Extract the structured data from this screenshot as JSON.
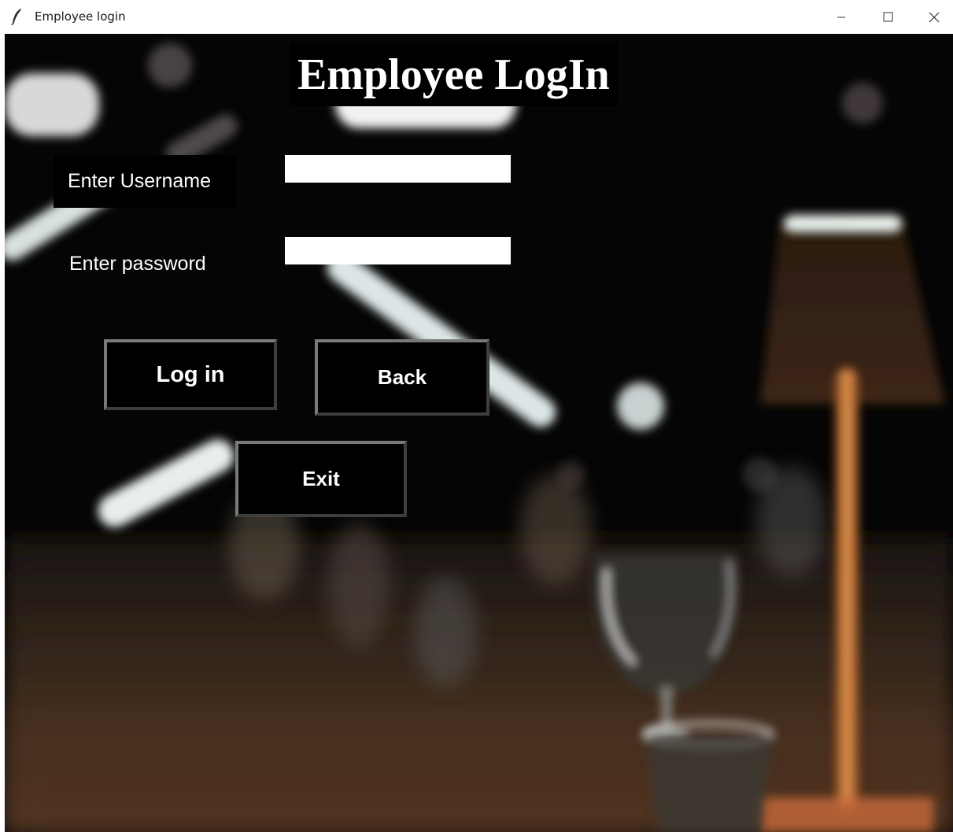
{
  "window": {
    "title": "Employee login",
    "icon": "feather-icon",
    "controls": [
      "minimize-icon",
      "maximize-icon",
      "close-icon"
    ]
  },
  "form": {
    "heading": "Employee LogIn",
    "username_label": "Enter Username",
    "username_value": "",
    "password_label": "Enter password",
    "password_value": ""
  },
  "buttons": {
    "login": "Log in",
    "back": "Back",
    "exit": "Exit"
  },
  "colors": {
    "background": "#050505",
    "label_bg": "#000000",
    "text": "#ffffff",
    "input_bg": "#ffffff",
    "button_border": "#7a7a7a"
  }
}
